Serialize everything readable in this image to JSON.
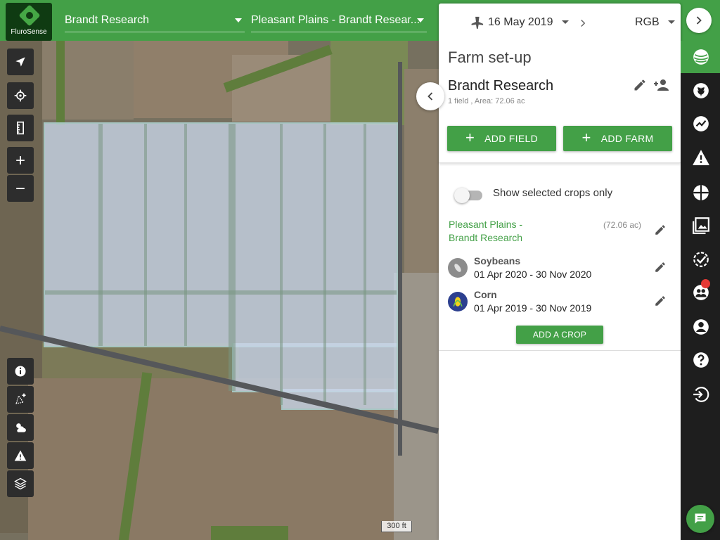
{
  "app": {
    "logo_text": "FluroSense",
    "brand_color": "#43a047"
  },
  "topbar": {
    "farm_selector": "Brandt Research",
    "field_selector": "Pleasant Plains - Brandt Resear..."
  },
  "panel": {
    "date": "16 May 2019",
    "layer": "RGB",
    "title": "Farm set-up",
    "farm_name": "Brandt Research",
    "farm_meta": "1 field , Area: 72.06 ac",
    "add_field_label": "ADD FIELD",
    "add_farm_label": "ADD FARM",
    "toggle_label": "Show selected crops only",
    "toggle_on": false,
    "field": {
      "name_line1": "Pleasant Plains -",
      "name_line2": "Brandt Research",
      "area": "(72.06 ac)"
    },
    "crops": [
      {
        "name": "Soybeans",
        "dates": "01 Apr 2020 - 30 Nov 2020",
        "icon": "soybean-icon"
      },
      {
        "name": "Corn",
        "dates": "01 Apr 2019 - 30 Nov 2019",
        "icon": "corn-icon"
      }
    ],
    "add_crop_label": "ADD A CROP"
  },
  "map": {
    "scale_label": "300 ft"
  },
  "left_tools": [
    "location-arrow-icon",
    "crosshair-icon",
    "ruler-icon",
    "zoom-in-icon",
    "zoom-out-icon",
    "info-icon",
    "draw-polygon-icon",
    "weather-icon",
    "warning-icon",
    "layers-icon"
  ],
  "right_rail": [
    "farm-globe-icon",
    "crop-icon",
    "analytics-icon",
    "alert-icon",
    "zones-icon",
    "images-icon",
    "checklist-icon",
    "users-icon",
    "account-icon",
    "help-icon",
    "logout-icon",
    "chat-icon"
  ]
}
